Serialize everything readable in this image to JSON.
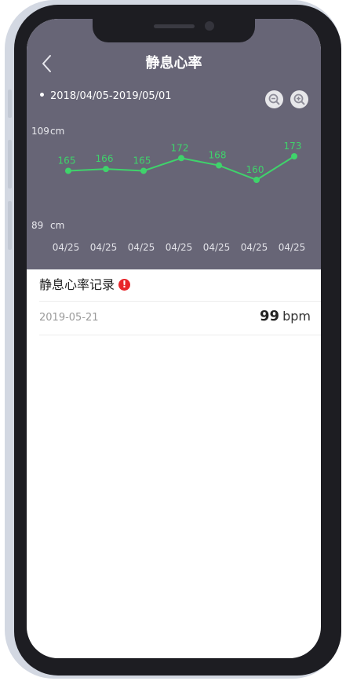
{
  "header": {
    "title": "静息心率",
    "date_range": "2018/04/05-2019/05/01"
  },
  "chart_data": {
    "type": "line",
    "y_top_label": "109",
    "y_bottom_label": "89",
    "y_unit": "cm",
    "ylim": [
      89,
      109
    ],
    "categories": [
      "04/25",
      "04/25",
      "04/25",
      "04/25",
      "04/25",
      "04/25",
      "04/25"
    ],
    "values": [
      165,
      166,
      165,
      172,
      168,
      160,
      173
    ],
    "line_color": "#3fd36b",
    "grid": false
  },
  "records": {
    "section_title": "静息心率记录",
    "alert_icon": "!",
    "items": [
      {
        "date": "2019-05-21",
        "value": "99",
        "unit": "bpm"
      }
    ]
  },
  "colors": {
    "header_bg": "#676576",
    "accent": "#3fd36b",
    "alert": "#e8262b"
  }
}
